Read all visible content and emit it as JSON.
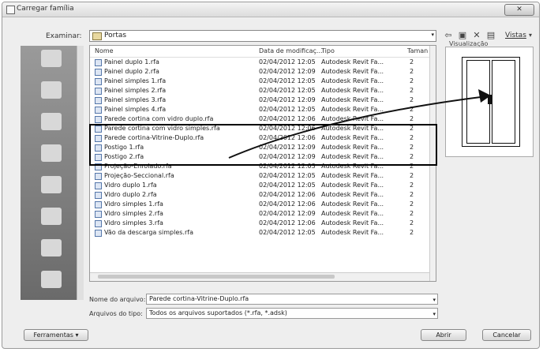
{
  "window": {
    "title": "Carregar família",
    "close_label": "✕"
  },
  "lookin": {
    "label": "Examinar:",
    "value": "Portas",
    "arrow": "▾"
  },
  "toolbar": {
    "back_icon": "⇦",
    "folder_icon": "▣",
    "delete_icon": "✕",
    "views_icon": "▤",
    "views_label": "Vistas",
    "views_arrow": "▾"
  },
  "preview": {
    "label": "Visualização"
  },
  "places": {
    "labels": [
      "",
      "",
      "",
      "",
      "",
      "",
      "",
      ""
    ]
  },
  "list": {
    "headers": [
      "Nome",
      "Data de modificaç...",
      "Tipo",
      "Taman"
    ],
    "rows": [
      {
        "name": "Painel duplo 1.rfa",
        "date": "02/04/2012 12:05",
        "type": "Autodesk Revit Fa...",
        "size": "2"
      },
      {
        "name": "Painel duplo 2.rfa",
        "date": "02/04/2012 12:09",
        "type": "Autodesk Revit Fa...",
        "size": "2"
      },
      {
        "name": "Painel simples 1.rfa",
        "date": "02/04/2012 12:05",
        "type": "Autodesk Revit Fa...",
        "size": "2"
      },
      {
        "name": "Painel simples 2.rfa",
        "date": "02/04/2012 12:05",
        "type": "Autodesk Revit Fa...",
        "size": "2"
      },
      {
        "name": "Painel simples 3.rfa",
        "date": "02/04/2012 12:09",
        "type": "Autodesk Revit Fa...",
        "size": "2"
      },
      {
        "name": "Painel simples 4.rfa",
        "date": "02/04/2012 12:05",
        "type": "Autodesk Revit Fa...",
        "size": "2"
      },
      {
        "name": "Parede cortina com vidro duplo.rfa",
        "date": "02/04/2012 12:06",
        "type": "Autodesk Revit Fa...",
        "size": "2"
      },
      {
        "name": "Parede cortina com vidro simples.rfa",
        "date": "02/04/2012 12:06",
        "type": "Autodesk Revit Fa...",
        "size": "2"
      },
      {
        "name": "Parede cortina-Vitrine-Duplo.rfa",
        "date": "02/04/2012 12:06",
        "type": "Autodesk Revit Fa...",
        "size": "2"
      },
      {
        "name": "Postigo 1.rfa",
        "date": "02/04/2012 12:09",
        "type": "Autodesk Revit Fa...",
        "size": "2"
      },
      {
        "name": "Postigo 2.rfa",
        "date": "02/04/2012 12:09",
        "type": "Autodesk Revit Fa...",
        "size": "2"
      },
      {
        "name": "Projeção-Enrolado.rfa",
        "date": "02/04/2012 12:03",
        "type": "Autodesk Revit Fa...",
        "size": "2"
      },
      {
        "name": "Projeção-Seccional.rfa",
        "date": "02/04/2012 12:05",
        "type": "Autodesk Revit Fa...",
        "size": "2"
      },
      {
        "name": "Vidro duplo 1.rfa",
        "date": "02/04/2012 12:05",
        "type": "Autodesk Revit Fa...",
        "size": "2"
      },
      {
        "name": "Vidro duplo 2.rfa",
        "date": "02/04/2012 12:06",
        "type": "Autodesk Revit Fa...",
        "size": "2"
      },
      {
        "name": "Vidro simples 1.rfa",
        "date": "02/04/2012 12:06",
        "type": "Autodesk Revit Fa...",
        "size": "2"
      },
      {
        "name": "Vidro simples 2.rfa",
        "date": "02/04/2012 12:09",
        "type": "Autodesk Revit Fa...",
        "size": "2"
      },
      {
        "name": "Vidro simples 3.rfa",
        "date": "02/04/2012 12:06",
        "type": "Autodesk Revit Fa...",
        "size": "2"
      },
      {
        "name": "Vão da descarga simples.rfa",
        "date": "02/04/2012 12:05",
        "type": "Autodesk Revit Fa...",
        "size": "2"
      }
    ]
  },
  "filename": {
    "label": "Nome do arquivo:",
    "value": "Parede cortina-Vitrine-Duplo.rfa",
    "arrow": "▾"
  },
  "filetype": {
    "label": "Arquivos do tipo:",
    "value": "Todos os arquivos suportados (*.rfa, *.adsk)",
    "arrow": "▾"
  },
  "buttons": {
    "tools": "Ferramentas",
    "tools_arrow": "▾",
    "open": "Abrir",
    "cancel": "Cancelar"
  },
  "colors": {
    "highlight_border": "#000000",
    "places_bg": "#7a7a7a",
    "dialog_bg": "#eeeeee"
  }
}
